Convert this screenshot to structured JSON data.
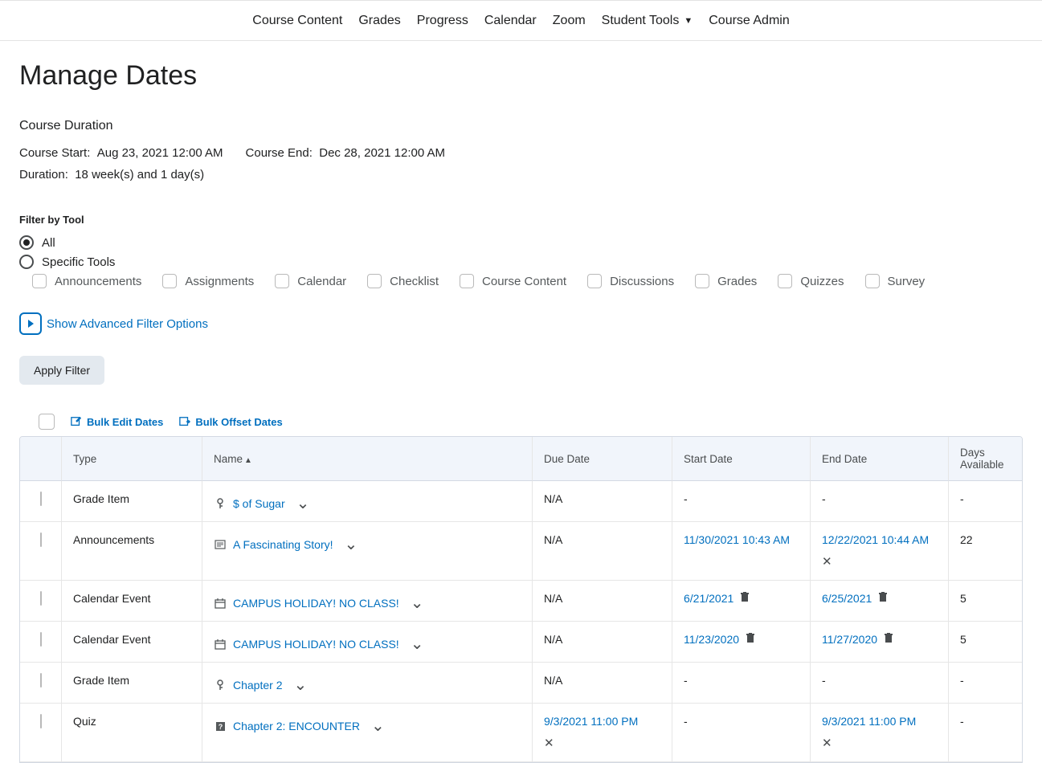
{
  "nav": {
    "items": [
      {
        "label": "Course Content",
        "has_caret": false
      },
      {
        "label": "Grades",
        "has_caret": false
      },
      {
        "label": "Progress",
        "has_caret": false
      },
      {
        "label": "Calendar",
        "has_caret": false
      },
      {
        "label": "Zoom",
        "has_caret": false
      },
      {
        "label": "Student Tools",
        "has_caret": true
      },
      {
        "label": "Course Admin",
        "has_caret": false
      }
    ]
  },
  "page_title": "Manage Dates",
  "duration": {
    "heading": "Course Duration",
    "start_label": "Course Start:",
    "start_value": "Aug 23, 2021 12:00 AM",
    "end_label": "Course End:",
    "end_value": "Dec 28, 2021 12:00 AM",
    "dur_label": "Duration:",
    "dur_value": "18 week(s) and 1 day(s)"
  },
  "filter": {
    "heading": "Filter by Tool",
    "all_label": "All",
    "specific_label": "Specific Tools",
    "tools": [
      "Announcements",
      "Assignments",
      "Calendar",
      "Checklist",
      "Course Content",
      "Discussions",
      "Grades",
      "Quizzes",
      "Survey"
    ],
    "adv_label": "Show Advanced Filter Options",
    "apply_label": "Apply Filter"
  },
  "bulk": {
    "edit_label": "Bulk Edit Dates",
    "offset_label": "Bulk Offset Dates"
  },
  "table": {
    "headers": {
      "type": "Type",
      "name": "Name",
      "due": "Due Date",
      "start": "Start Date",
      "end": "End Date",
      "days": "Days Available"
    },
    "rows": [
      {
        "type": "Grade Item",
        "icon": "key",
        "name": "$ of Sugar",
        "due": "N/A",
        "start": "-",
        "end": "-",
        "end_icon": "",
        "start_icon": "",
        "days": "-"
      },
      {
        "type": "Announcements",
        "icon": "news",
        "name": "A Fascinating Story!",
        "due": "N/A",
        "start": "11/30/2021 10:43 AM",
        "start_icon": "",
        "end": "12/22/2021 10:44 AM",
        "end_icon": "x",
        "days": "22"
      },
      {
        "type": "Calendar Event",
        "icon": "calendar",
        "name": "CAMPUS HOLIDAY! NO CLASS!",
        "due": "N/A",
        "start": "6/21/2021",
        "start_icon": "trash",
        "end": "6/25/2021",
        "end_icon": "trash",
        "days": "5"
      },
      {
        "type": "Calendar Event",
        "icon": "calendar",
        "name": "CAMPUS HOLIDAY! NO CLASS!",
        "due": "N/A",
        "start": "11/23/2020",
        "start_icon": "trash",
        "end": "11/27/2020",
        "end_icon": "trash",
        "days": "5"
      },
      {
        "type": "Grade Item",
        "icon": "key",
        "name": "Chapter 2",
        "due": "N/A",
        "start": "-",
        "start_icon": "",
        "end": "-",
        "end_icon": "",
        "days": "-"
      },
      {
        "type": "Quiz",
        "icon": "quiz",
        "name": "Chapter 2: ENCOUNTER",
        "due": "9/3/2021 11:00 PM",
        "due_icon": "x",
        "start": "-",
        "start_icon": "",
        "end": "9/3/2021 11:00 PM",
        "end_icon": "x",
        "days": "-"
      }
    ]
  }
}
